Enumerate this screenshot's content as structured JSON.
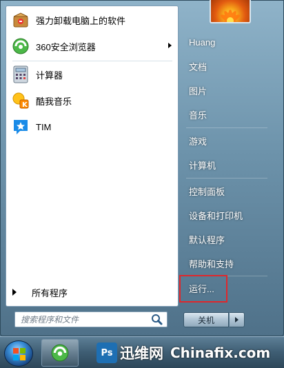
{
  "left_panel": {
    "pinned": [
      {
        "label": "强力卸载电脑上的软件",
        "icon": "box-uninstall-icon"
      },
      {
        "label": "360安全浏览器",
        "icon": "browser-360-icon",
        "has_submenu": true
      }
    ],
    "recent": [
      {
        "label": "计算器",
        "icon": "calculator-icon"
      },
      {
        "label": "酷我音乐",
        "icon": "kuwo-music-icon"
      },
      {
        "label": "TIM",
        "icon": "tim-icon"
      }
    ],
    "all_programs": "所有程序"
  },
  "search": {
    "placeholder": "搜索程序和文件"
  },
  "right_panel": {
    "items": [
      "Huang",
      "文档",
      "图片",
      "音乐",
      "游戏",
      "计算机",
      "控制面板",
      "设备和打印机",
      "默认程序",
      "帮助和支持",
      "运行..."
    ]
  },
  "shutdown": {
    "label": "关机"
  },
  "watermark": {
    "badge": "Ps",
    "cn": "迅维网",
    "en": "Chinafix.com"
  },
  "colors": {
    "highlight_box": "#e0272b",
    "panel_bg": "#ffffff"
  }
}
